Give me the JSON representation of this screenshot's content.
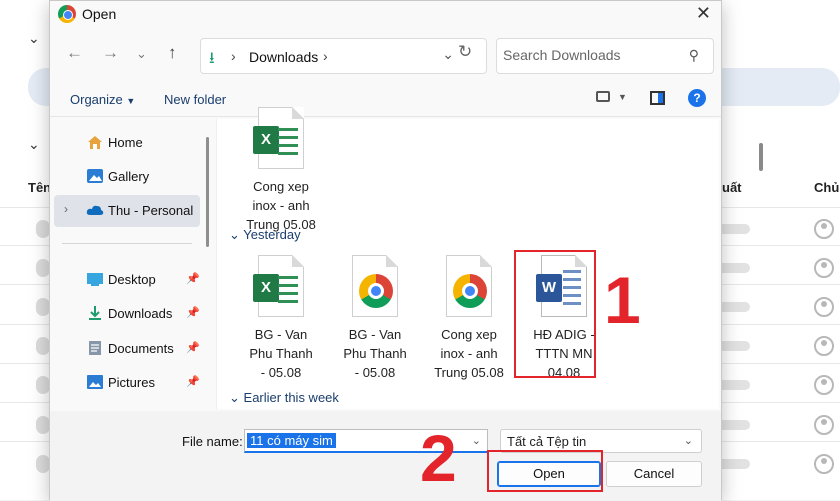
{
  "background_page": {
    "col_header_left": "Tên",
    "col_header_mid": "uất",
    "col_header_right": "Chủ"
  },
  "dialog": {
    "title": "Open",
    "nav": {
      "path_label": "Downloads",
      "search_placeholder": "Search Downloads"
    },
    "toolbar": {
      "organize": "Organize",
      "new_folder": "New folder"
    },
    "sidebar": {
      "items": [
        {
          "label": "Home",
          "icon": "home-icon"
        },
        {
          "label": "Gallery",
          "icon": "gallery-icon"
        },
        {
          "label": "Thu - Personal",
          "icon": "cloud-icon",
          "selected": true
        },
        {
          "label": "Desktop",
          "icon": "desktop-icon",
          "pinned": true
        },
        {
          "label": "Downloads",
          "icon": "download-icon",
          "pinned": true
        },
        {
          "label": "Documents",
          "icon": "documents-icon",
          "pinned": true
        },
        {
          "label": "Pictures",
          "icon": "pictures-icon",
          "pinned": true
        }
      ]
    },
    "groups": {
      "yesterday": "Yesterday",
      "earlier": "Earlier this week"
    },
    "files": [
      {
        "name_lines": [
          "Cong xep",
          "inox - anh",
          "Trung 05.08"
        ],
        "type": "excel"
      },
      {
        "name_lines": [
          "BG - Van",
          "Phu Thanh",
          "- 05.08"
        ],
        "type": "excel"
      },
      {
        "name_lines": [
          "BG - Van",
          "Phu Thanh",
          "- 05.08"
        ],
        "type": "chrome"
      },
      {
        "name_lines": [
          "Cong xep",
          "inox - anh",
          "Trung 05.08"
        ],
        "type": "chrome"
      },
      {
        "name_lines": [
          "HĐ ADIG -",
          "TTTN MN",
          "04.08"
        ],
        "type": "word"
      }
    ],
    "footer": {
      "file_name_label": "File name:",
      "file_name_value": "11 có máy sim",
      "file_type": "Tất cả Tệp tin",
      "open_label": "Open",
      "cancel_label": "Cancel"
    }
  },
  "markers": {
    "step1": "1",
    "step2": "2"
  },
  "colors": {
    "accent": "#1a73e8",
    "highlight": "#e3242b",
    "excel": "#1f7a45",
    "word": "#2b579a"
  }
}
